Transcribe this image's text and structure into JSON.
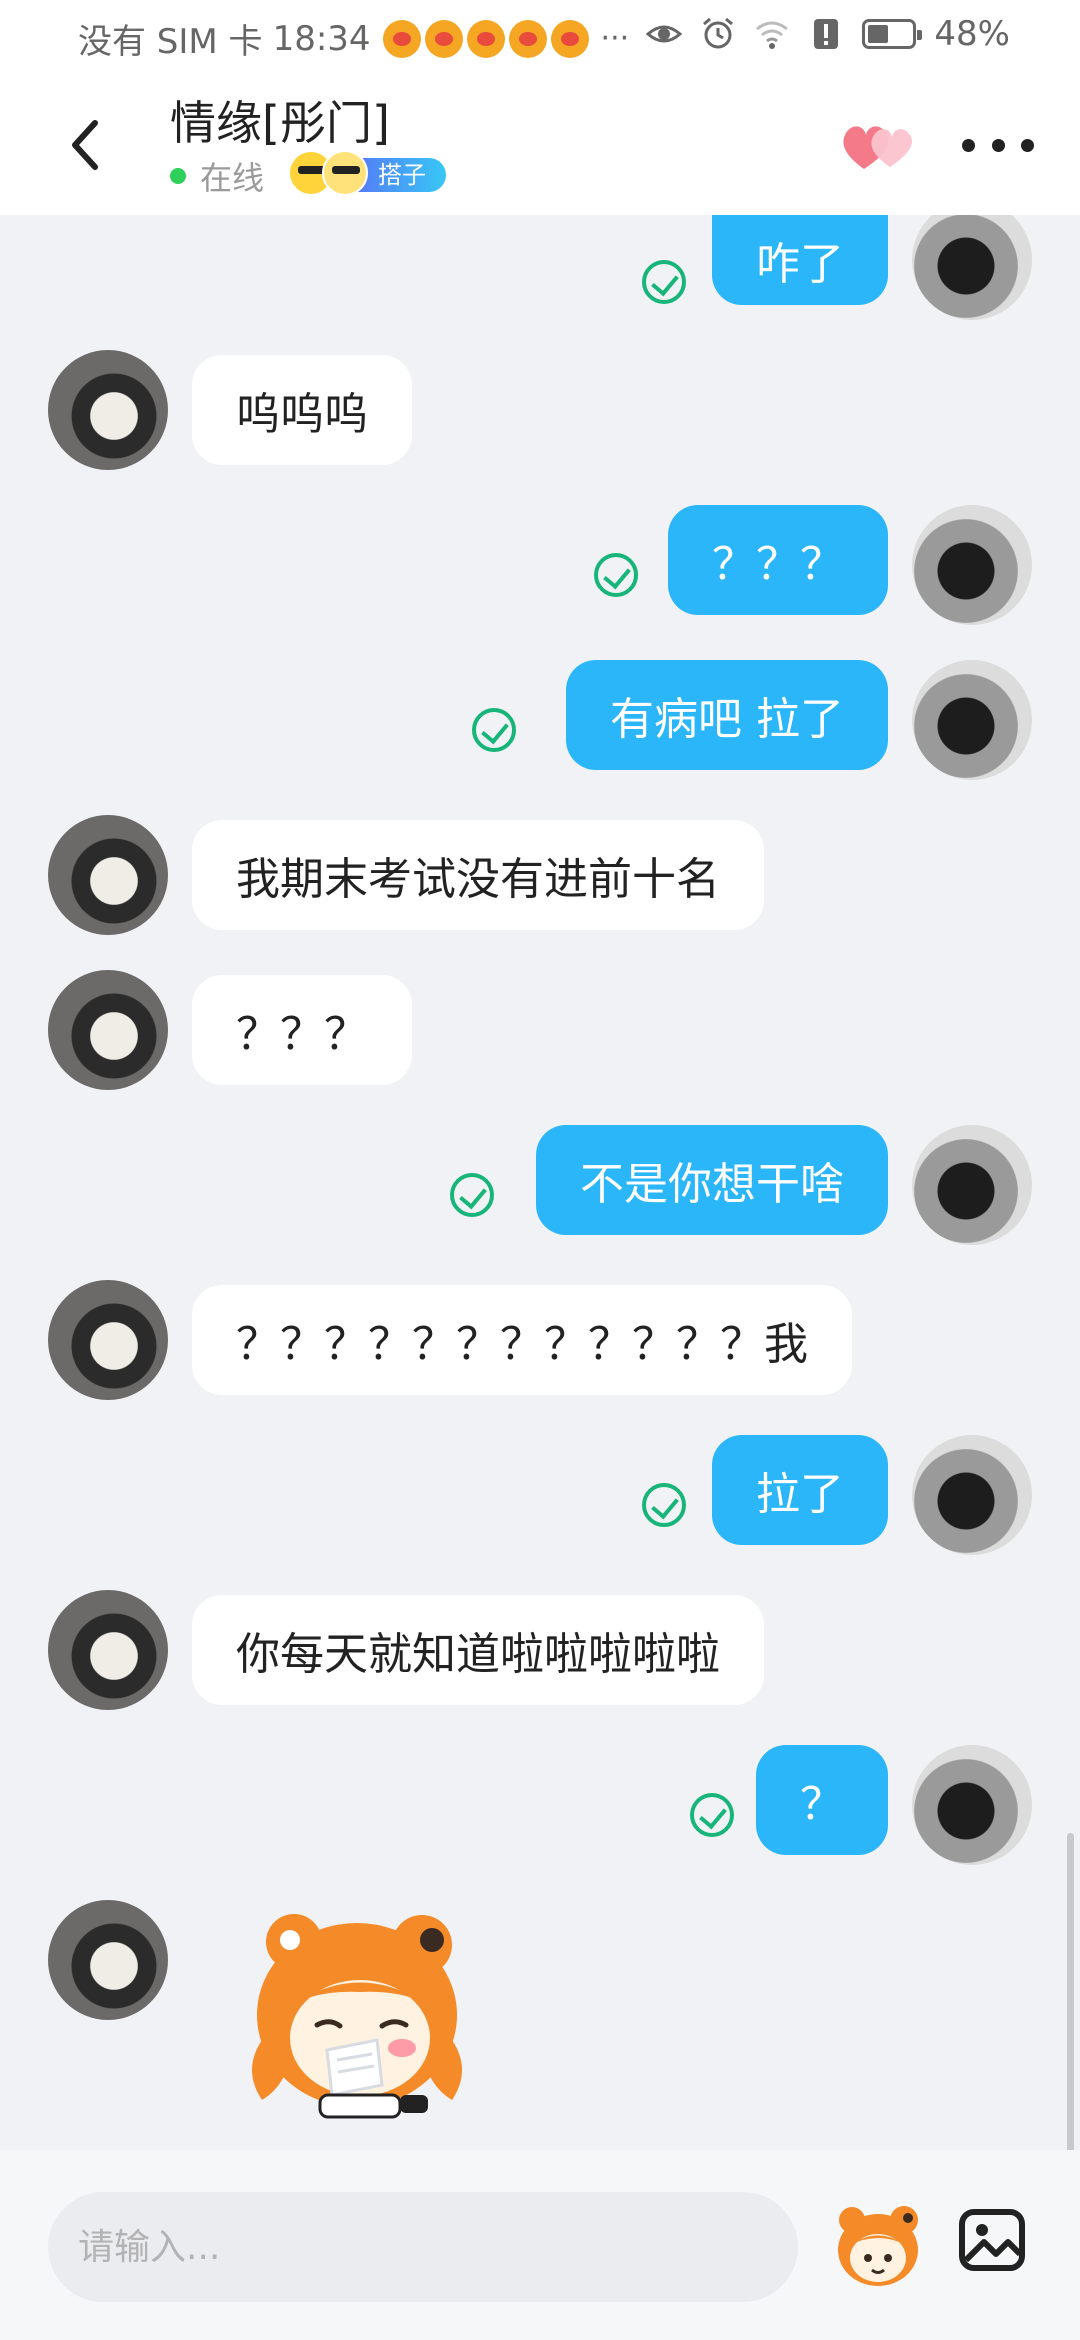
{
  "status_bar": {
    "carrier": "没有 SIM 卡",
    "time": "18:34",
    "more_notifications": "···",
    "battery": "48%"
  },
  "header": {
    "contact_name": "情缘[彤门]",
    "presence": "在线",
    "badge_label": "搭子"
  },
  "messages": [
    {
      "from": "me",
      "text": "咋了"
    },
    {
      "from": "them",
      "text": "呜呜呜"
    },
    {
      "from": "me",
      "text": "？？？"
    },
    {
      "from": "me",
      "text": "有病吧  拉了"
    },
    {
      "from": "them",
      "text": "我期末考试没有进前十名"
    },
    {
      "from": "them",
      "text": "？？？"
    },
    {
      "from": "me",
      "text": "不是你想干啥"
    },
    {
      "from": "them",
      "text": "？？？？？？？？？？？？我"
    },
    {
      "from": "me",
      "text": "拉了"
    },
    {
      "from": "them",
      "text": "你每天就知道啦啦啦啦啦"
    },
    {
      "from": "me",
      "text": "？"
    },
    {
      "from": "them",
      "type": "sticker",
      "sticker": "crying-character"
    }
  ],
  "input": {
    "placeholder": "请输入..."
  },
  "colors": {
    "my_bubble": "#2ab6f9",
    "their_bubble": "#ffffff",
    "background": "#f1f2f6",
    "read_check": "#18b57a",
    "online": "#2fd05a"
  },
  "icons": [
    "back-arrow-icon",
    "hearts-icon",
    "more-icon",
    "sticker-icon",
    "image-icon",
    "read-check-icon"
  ]
}
